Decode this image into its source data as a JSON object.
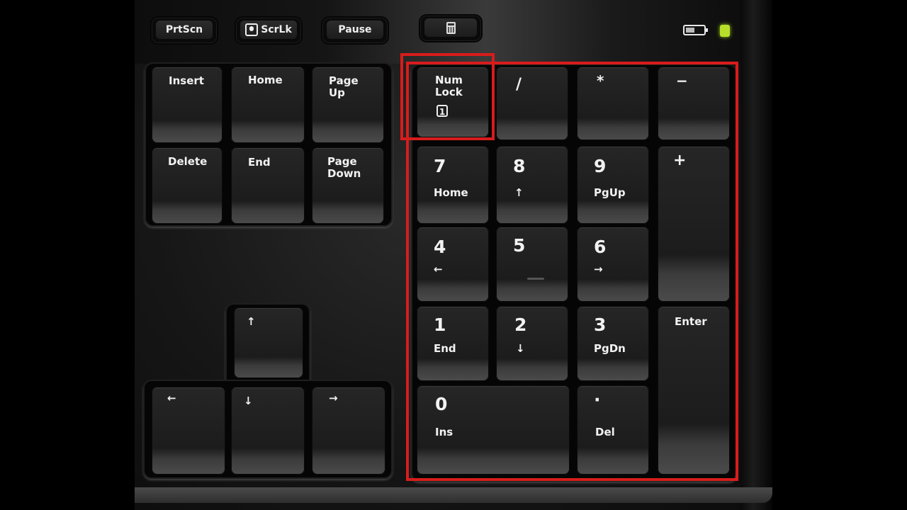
{
  "scene": {
    "description": "Close-up photo of a keyboard's navigation cluster and numeric keypad with the numpad highlighted",
    "highlight_color": "#d81c1c"
  },
  "top_row": {
    "prtscn": "PrtScn",
    "scrlk": "ScrLk",
    "pause": "Pause",
    "calculator_icon": "calculator-icon"
  },
  "indicators": {
    "battery_icon": "battery-icon",
    "status_led_color": "#b8e02a"
  },
  "nav_cluster": {
    "insert": "Insert",
    "home": "Home",
    "page_up": "Page\nUp",
    "delete": "Delete",
    "end": "End",
    "page_down": "Page\nDown"
  },
  "arrow_keys": {
    "up": "↑",
    "left": "←",
    "down": "↓",
    "right": "→"
  },
  "numpad": {
    "num_lock": "Num\nLock",
    "num_lock_indicator": "1",
    "divide": "/",
    "multiply": "*",
    "minus": "−",
    "plus": "+",
    "enter": "Enter",
    "k7": {
      "main": "7",
      "sub": "Home"
    },
    "k8": {
      "main": "8",
      "sub": "↑"
    },
    "k9": {
      "main": "9",
      "sub": "PgUp"
    },
    "k4": {
      "main": "4",
      "sub": "←"
    },
    "k5": {
      "main": "5",
      "sub": ""
    },
    "k6": {
      "main": "6",
      "sub": "→"
    },
    "k1": {
      "main": "1",
      "sub": "End"
    },
    "k2": {
      "main": "2",
      "sub": "↓"
    },
    "k3": {
      "main": "3",
      "sub": "PgDn"
    },
    "k0": {
      "main": "0",
      "sub": "Ins"
    },
    "kdot": {
      "main": "·",
      "sub": "Del"
    }
  }
}
